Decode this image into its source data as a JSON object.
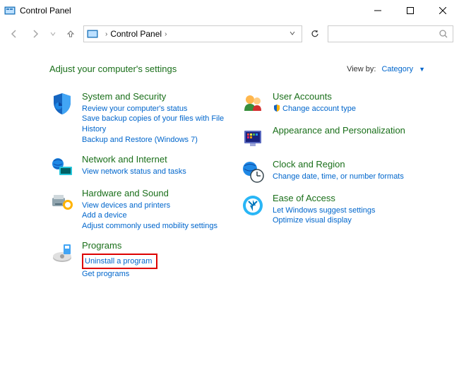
{
  "window": {
    "title": "Control Panel"
  },
  "breadcrumb": {
    "root": "Control Panel"
  },
  "header": {
    "page_title": "Adjust your computer's settings",
    "view_by_label": "View by:",
    "view_by_mode": "Category"
  },
  "categories_left": [
    {
      "icon": "shield",
      "name": "System and Security",
      "tasks": [
        {
          "label": "Review your computer's status"
        },
        {
          "label": "Save backup copies of your files with File History"
        },
        {
          "label": "Backup and Restore (Windows 7)"
        }
      ]
    },
    {
      "icon": "network",
      "name": "Network and Internet",
      "tasks": [
        {
          "label": "View network status and tasks"
        }
      ]
    },
    {
      "icon": "hardware",
      "name": "Hardware and Sound",
      "tasks": [
        {
          "label": "View devices and printers"
        },
        {
          "label": "Add a device"
        },
        {
          "label": "Adjust commonly used mobility settings"
        }
      ]
    },
    {
      "icon": "programs",
      "name": "Programs",
      "tasks": [
        {
          "label": "Uninstall a program",
          "highlight": true
        },
        {
          "label": "Get programs"
        }
      ]
    }
  ],
  "categories_right": [
    {
      "icon": "users",
      "name": "User Accounts",
      "tasks": [
        {
          "label": "Change account type",
          "shield": true
        }
      ]
    },
    {
      "icon": "appearance",
      "name": "Appearance and Personalization",
      "tasks": []
    },
    {
      "icon": "clock",
      "name": "Clock and Region",
      "tasks": [
        {
          "label": "Change date, time, or number formats"
        }
      ]
    },
    {
      "icon": "ease",
      "name": "Ease of Access",
      "tasks": [
        {
          "label": "Let Windows suggest settings"
        },
        {
          "label": "Optimize visual display"
        }
      ]
    }
  ]
}
